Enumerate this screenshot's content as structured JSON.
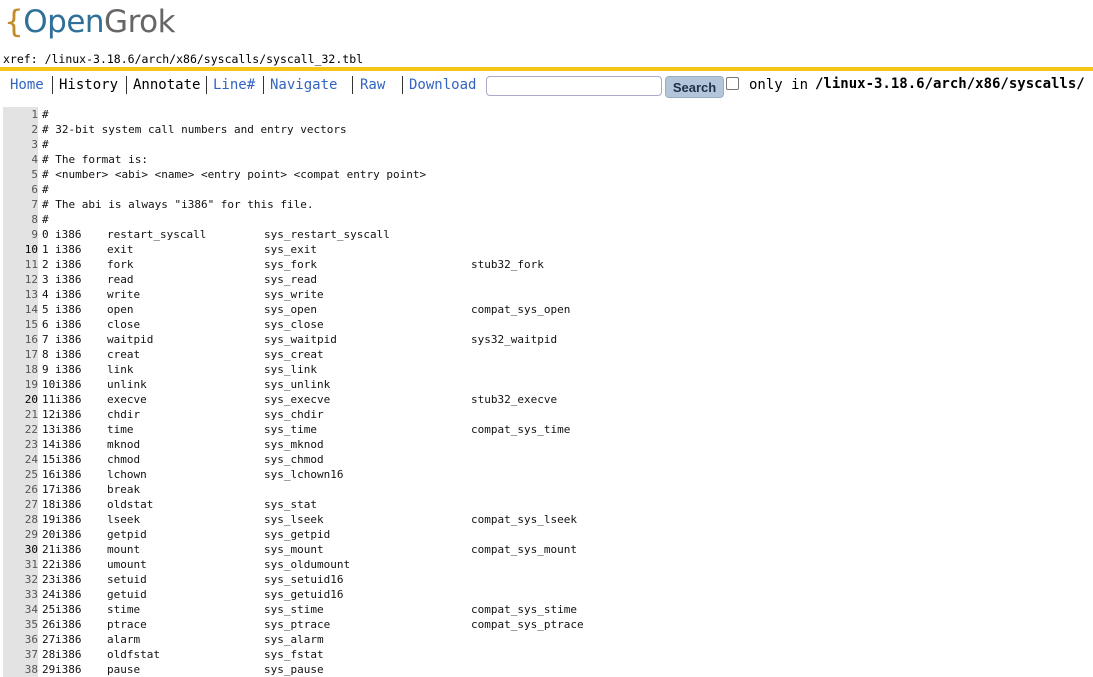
{
  "logo": {
    "brace": "{",
    "open": "Open",
    "grok": "Grok"
  },
  "xref": {
    "prefix": "xref:",
    "path": "/linux-3.18.6/arch/x86/syscalls/syscall_32.tbl"
  },
  "menu": {
    "home": "Home",
    "history": "History",
    "annotate": "Annotate",
    "line": "Line#",
    "navigate": "Navigate",
    "raw": "Raw",
    "download": "Download"
  },
  "search": {
    "value": "",
    "placeholder": "",
    "button_label": "Search",
    "only_in_label": "only in",
    "only_in_path": "/linux-3.18.6/arch/x86/syscalls/"
  },
  "colors": {
    "accent_bar": "#f5c518",
    "link": "#3364c2",
    "button": "#b3c6d9"
  },
  "code": {
    "comments": [
      {
        "num": "1",
        "text": "#"
      },
      {
        "num": "2",
        "text": "# 32-bit system call numbers and entry vectors"
      },
      {
        "num": "3",
        "text": "#"
      },
      {
        "num": "4",
        "text": "# The format is:"
      },
      {
        "num": "5",
        "text": "# <number> <abi> <name> <entry point> <compat entry point>"
      },
      {
        "num": "6",
        "text": "#"
      },
      {
        "num": "7",
        "text": "# The abi is always \"i386\" for this file."
      },
      {
        "num": "8",
        "text": "#"
      }
    ],
    "rows": [
      {
        "num": "9",
        "nr": "0",
        "abi": "i386",
        "name": "restart_syscall",
        "entry": "sys_restart_syscall",
        "compat": ""
      },
      {
        "num": "10",
        "nr": "1",
        "abi": "i386",
        "name": "exit",
        "entry": "sys_exit",
        "compat": ""
      },
      {
        "num": "11",
        "nr": "2",
        "abi": "i386",
        "name": "fork",
        "entry": "sys_fork",
        "compat": "stub32_fork"
      },
      {
        "num": "12",
        "nr": "3",
        "abi": "i386",
        "name": "read",
        "entry": "sys_read",
        "compat": ""
      },
      {
        "num": "13",
        "nr": "4",
        "abi": "i386",
        "name": "write",
        "entry": "sys_write",
        "compat": ""
      },
      {
        "num": "14",
        "nr": "5",
        "abi": "i386",
        "name": "open",
        "entry": "sys_open",
        "compat": "compat_sys_open"
      },
      {
        "num": "15",
        "nr": "6",
        "abi": "i386",
        "name": "close",
        "entry": "sys_close",
        "compat": ""
      },
      {
        "num": "16",
        "nr": "7",
        "abi": "i386",
        "name": "waitpid",
        "entry": "sys_waitpid",
        "compat": "sys32_waitpid"
      },
      {
        "num": "17",
        "nr": "8",
        "abi": "i386",
        "name": "creat",
        "entry": "sys_creat",
        "compat": ""
      },
      {
        "num": "18",
        "nr": "9",
        "abi": "i386",
        "name": "link",
        "entry": "sys_link",
        "compat": ""
      },
      {
        "num": "19",
        "nr": "10",
        "abi": "i386",
        "name": "unlink",
        "entry": "sys_unlink",
        "compat": ""
      },
      {
        "num": "20",
        "nr": "11",
        "abi": "i386",
        "name": "execve",
        "entry": "sys_execve",
        "compat": "stub32_execve"
      },
      {
        "num": "21",
        "nr": "12",
        "abi": "i386",
        "name": "chdir",
        "entry": "sys_chdir",
        "compat": ""
      },
      {
        "num": "22",
        "nr": "13",
        "abi": "i386",
        "name": "time",
        "entry": "sys_time",
        "compat": "compat_sys_time"
      },
      {
        "num": "23",
        "nr": "14",
        "abi": "i386",
        "name": "mknod",
        "entry": "sys_mknod",
        "compat": ""
      },
      {
        "num": "24",
        "nr": "15",
        "abi": "i386",
        "name": "chmod",
        "entry": "sys_chmod",
        "compat": ""
      },
      {
        "num": "25",
        "nr": "16",
        "abi": "i386",
        "name": "lchown",
        "entry": "sys_lchown16",
        "compat": ""
      },
      {
        "num": "26",
        "nr": "17",
        "abi": "i386",
        "name": "break",
        "entry": "",
        "compat": ""
      },
      {
        "num": "27",
        "nr": "18",
        "abi": "i386",
        "name": "oldstat",
        "entry": "sys_stat",
        "compat": ""
      },
      {
        "num": "28",
        "nr": "19",
        "abi": "i386",
        "name": "lseek",
        "entry": "sys_lseek",
        "compat": "compat_sys_lseek"
      },
      {
        "num": "29",
        "nr": "20",
        "abi": "i386",
        "name": "getpid",
        "entry": "sys_getpid",
        "compat": ""
      },
      {
        "num": "30",
        "nr": "21",
        "abi": "i386",
        "name": "mount",
        "entry": "sys_mount",
        "compat": "compat_sys_mount"
      },
      {
        "num": "31",
        "nr": "22",
        "abi": "i386",
        "name": "umount",
        "entry": "sys_oldumount",
        "compat": ""
      },
      {
        "num": "32",
        "nr": "23",
        "abi": "i386",
        "name": "setuid",
        "entry": "sys_setuid16",
        "compat": ""
      },
      {
        "num": "33",
        "nr": "24",
        "abi": "i386",
        "name": "getuid",
        "entry": "sys_getuid16",
        "compat": ""
      },
      {
        "num": "34",
        "nr": "25",
        "abi": "i386",
        "name": "stime",
        "entry": "sys_stime",
        "compat": "compat_sys_stime"
      },
      {
        "num": "35",
        "nr": "26",
        "abi": "i386",
        "name": "ptrace",
        "entry": "sys_ptrace",
        "compat": "compat_sys_ptrace"
      },
      {
        "num": "36",
        "nr": "27",
        "abi": "i386",
        "name": "alarm",
        "entry": "sys_alarm",
        "compat": ""
      },
      {
        "num": "37",
        "nr": "28",
        "abi": "i386",
        "name": "oldfstat",
        "entry": "sys_fstat",
        "compat": ""
      },
      {
        "num": "38",
        "nr": "29",
        "abi": "i386",
        "name": "pause",
        "entry": "sys_pause",
        "compat": ""
      }
    ],
    "emphasized_line_numbers": [
      "10",
      "20",
      "30"
    ]
  }
}
